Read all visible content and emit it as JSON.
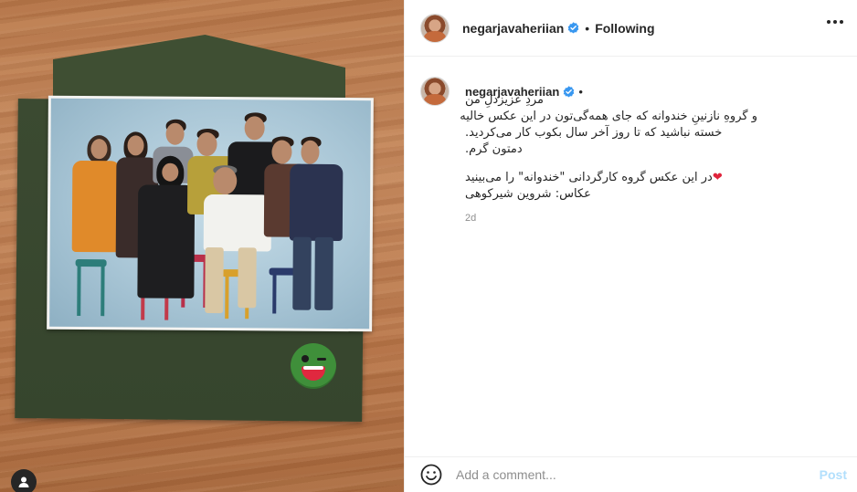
{
  "post": {
    "username": "negarjavaheriian",
    "follow_status": "Following",
    "separator": "•",
    "caption": {
      "line1": "مردِ عزیزدلِ من",
      "line2": "و گروهِ نازنینِ خندوانه که جای همه‌گی‌تون در این عکس خالیه",
      "line3": "خسته نباشید که تا روز آخر سال بکوب کار می‌کردید.",
      "line4": "دمتون گرم.",
      "line5": "در این عکس گروه کارگردانی \"خندوانه\" را می‌بینید",
      "line6": "عکاس: شروین شیرکوهی"
    },
    "timestamp": "2d"
  },
  "comment": {
    "placeholder": "Add a comment...",
    "post_label": "Post"
  },
  "icons": {
    "verified": "verified-badge-icon",
    "more": "more-options-icon",
    "emoji": "emoji-icon",
    "tag": "user-tag-icon",
    "heart": "heart-icon"
  },
  "colors": {
    "verified": "#3897f0",
    "post_disabled": "#b2dffc",
    "heart": "#e0243c",
    "muted": "#8e8e8e"
  }
}
